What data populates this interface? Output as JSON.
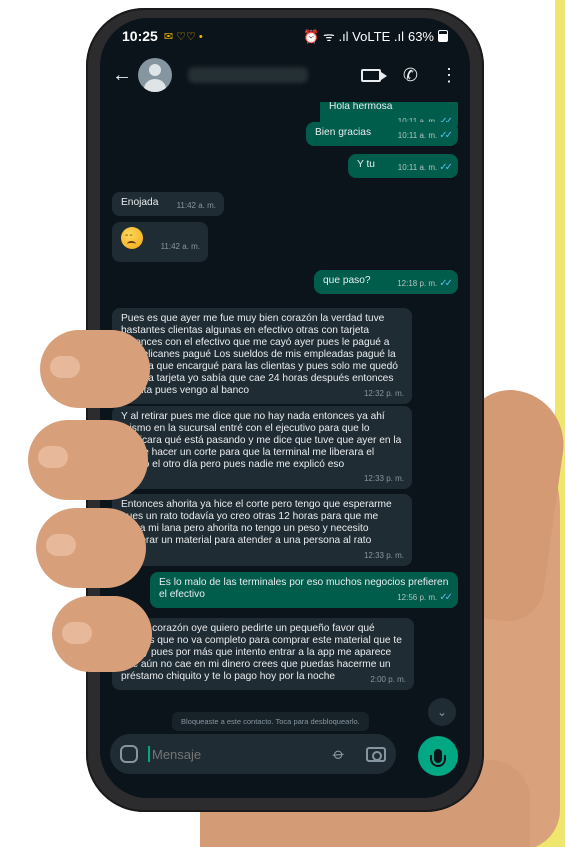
{
  "status_bar": {
    "time": "10:25",
    "notifications": "✉ ♡♡ •",
    "icons": "⏰ ᯤ .ıl VoLTE .ıl",
    "battery": "63%"
  },
  "header": {
    "back_icon": "arrow-left-icon",
    "video_icon": "video-call-icon",
    "call_icon": "phone-icon",
    "menu_icon": "more-vertical-icon"
  },
  "messages": [
    {
      "dir": "out",
      "text": "Hola hermosa",
      "time": "10:11 a. m."
    },
    {
      "dir": "out",
      "text": "Bien gracias",
      "time": "10:11 a. m."
    },
    {
      "dir": "out",
      "text": "Y tu",
      "time": "10:11 a. m."
    },
    {
      "dir": "in",
      "text": "Enojada",
      "time": "11:42 a. m."
    },
    {
      "dir": "in",
      "text": "😞",
      "time": "11:42 a. m."
    },
    {
      "dir": "out",
      "text": "que paso?",
      "time": "12:18 p. m."
    },
    {
      "dir": "in",
      "text": "Pues es que ayer me fue muy bien corazón la verdad tuve bastantes clientas algunas en efectivo otras con tarjeta entonces con el efectivo que me cayó ayer pues le pagué a las delicanes pagué Los sueldos de mis empleadas pagué la comida que encargué para las clientas y pues solo me quedó lo de la tarjeta yo sabía que cae 24 horas después entonces ahorita pues vengo al banco",
      "time": "12:32 p. m."
    },
    {
      "dir": "in",
      "text": "Y al retirar pues me dice que no hay nada entonces ya ahí mismo en la sucursal entré con el ejecutivo para que lo explicara qué está pasando y me dice que tuve que ayer en la noche hacer un corte para que la terminal me liberara el dinero el otro día pero pues nadie me explicó eso",
      "time": "12:33 p. m."
    },
    {
      "dir": "in",
      "text": "Entonces ahorita ya hice el corte pero tengo que esperarme pues un rato todavía yo creo otras 12 horas para que me caiga mi lana pero ahorita no tengo un peso y necesito comprar un material para atender a una persona al rato",
      "time": "12:33 p. m."
    },
    {
      "dir": "out",
      "text": "Es lo malo de las terminales por eso muchos negocios prefieren el efectivo",
      "time": "12:56 p. m."
    },
    {
      "dir": "in",
      "text": "Así es corazón oye quiero pedirte un pequeño favor qué quieres que no va completo para comprar este material que te digo y pues por más que intento entrar a la app me aparece que aún no cae en mi dinero crees que puedas hacerme un préstamo chiquito y te lo pago hoy por la noche",
      "time": "2:00 p. m."
    }
  ],
  "system_note": "Bloqueaste a este contacto. Toca para desbloquearlo.",
  "input": {
    "placeholder": "Mensaje",
    "sticker_icon": "sticker-icon",
    "attach_icon": "paperclip-icon",
    "camera_icon": "camera-icon",
    "mic_icon": "microphone-icon"
  },
  "colors": {
    "background": "#efe66e",
    "chat_bg": "#0b141a",
    "bubble_out": "#005c4b",
    "bubble_in": "#202c33",
    "accent": "#00a884",
    "read_ticks": "#53bdeb"
  }
}
